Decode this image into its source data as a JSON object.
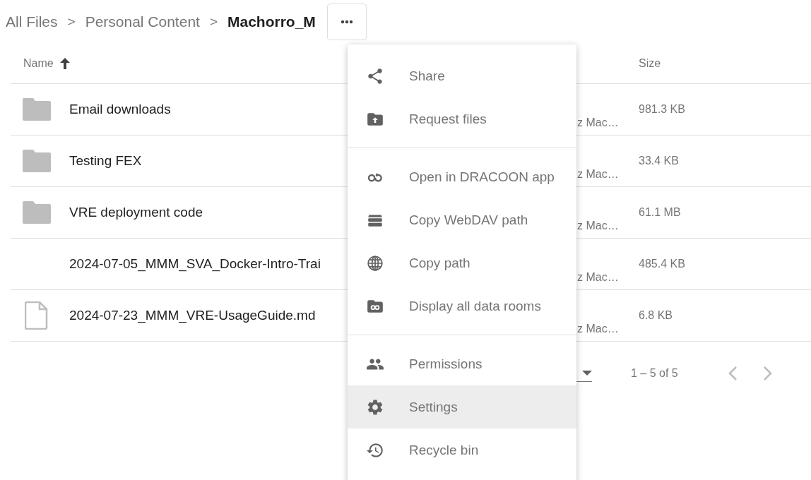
{
  "breadcrumb": [
    {
      "kind": "link",
      "label": "All Files"
    },
    {
      "kind": "separator",
      "label": ">"
    },
    {
      "kind": "link",
      "label": "Personal Content"
    },
    {
      "kind": "separator",
      "label": ">"
    },
    {
      "kind": "current",
      "label": "Machorro_M"
    }
  ],
  "table": {
    "columns": [
      {
        "label": "Name",
        "sorted": true
      },
      {
        "label": "Size",
        "sorted": false
      }
    ],
    "rows": [
      {
        "kind": "folder",
        "name": "Email downloads",
        "column_3": "z Mac…",
        "size": "981.3 KB"
      },
      {
        "kind": "folder",
        "name": "Testing FEX",
        "column_3": "z Mac…",
        "size": "33.4 KB"
      },
      {
        "kind": "folder",
        "name": "VRE deployment code",
        "column_3": "z Mac…",
        "size": "61.1 MB"
      },
      {
        "kind": "none",
        "name": "2024-07-05_MMM_SVA_Docker-Intro-Trai",
        "column_3": "z Mac…",
        "size": "485.4 KB"
      },
      {
        "kind": "file",
        "name": "2024-07-23_MMM_VRE-UsageGuide.md",
        "column_3": "z Mac…",
        "size": "6.8 KB"
      }
    ]
  },
  "pagination": {
    "range": "1 – 5 of 5"
  },
  "menu": {
    "groups": [
      {
        "items": [
          {
            "kind": "share",
            "label": "Share",
            "selected": false
          },
          {
            "kind": "request",
            "label": "Request files",
            "selected": false
          }
        ]
      },
      {
        "items": [
          {
            "kind": "app",
            "label": "Open in DRACOON app",
            "selected": false
          },
          {
            "kind": "webdav",
            "label": "Copy WebDAV path",
            "selected": false
          },
          {
            "kind": "path",
            "label": "Copy path",
            "selected": false
          },
          {
            "kind": "rooms",
            "label": "Display all data rooms",
            "selected": false
          }
        ]
      },
      {
        "items": [
          {
            "kind": "permissions",
            "label": "Permissions",
            "selected": false
          },
          {
            "kind": "settings",
            "label": "Settings",
            "selected": true
          },
          {
            "kind": "recycle",
            "label": "Recycle bin",
            "selected": false
          }
        ]
      }
    ]
  }
}
